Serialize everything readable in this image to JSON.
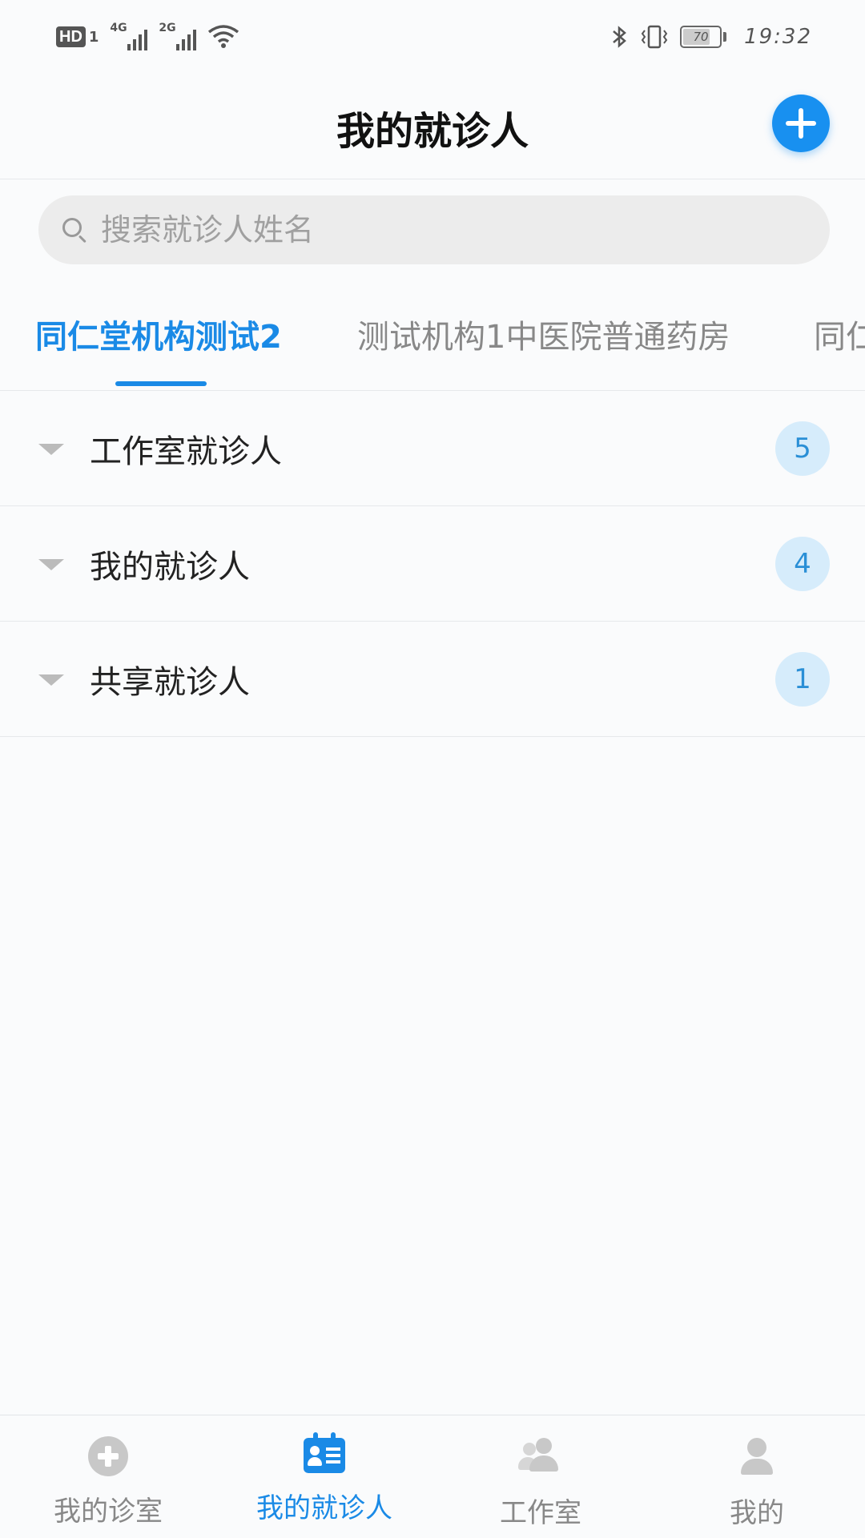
{
  "status_bar": {
    "hd_label": "HD",
    "sim_number": "1",
    "network_1": "4G",
    "network_2": "2G",
    "battery_level": "70",
    "time": "19:32"
  },
  "header": {
    "title": "我的就诊人"
  },
  "search": {
    "placeholder": "搜索就诊人姓名"
  },
  "tabs": [
    {
      "label": "同仁堂机构测试2",
      "active": true
    },
    {
      "label": "测试机构1中医院普通药房",
      "active": false
    },
    {
      "label": "同仁",
      "active": false
    }
  ],
  "groups": [
    {
      "label": "工作室就诊人",
      "count": "5"
    },
    {
      "label": "我的就诊人",
      "count": "4"
    },
    {
      "label": "共享就诊人",
      "count": "1"
    }
  ],
  "bottom_nav": [
    {
      "label": "我的诊室",
      "icon": "clinic-icon",
      "active": false
    },
    {
      "label": "我的就诊人",
      "icon": "patient-card-icon",
      "active": true
    },
    {
      "label": "工作室",
      "icon": "studio-people-icon",
      "active": false
    },
    {
      "label": "我的",
      "icon": "user-icon",
      "active": false
    }
  ],
  "colors": {
    "accent": "#1a8ae6",
    "add_button": "#1890f0",
    "count_badge_bg": "#d6ecfb"
  }
}
